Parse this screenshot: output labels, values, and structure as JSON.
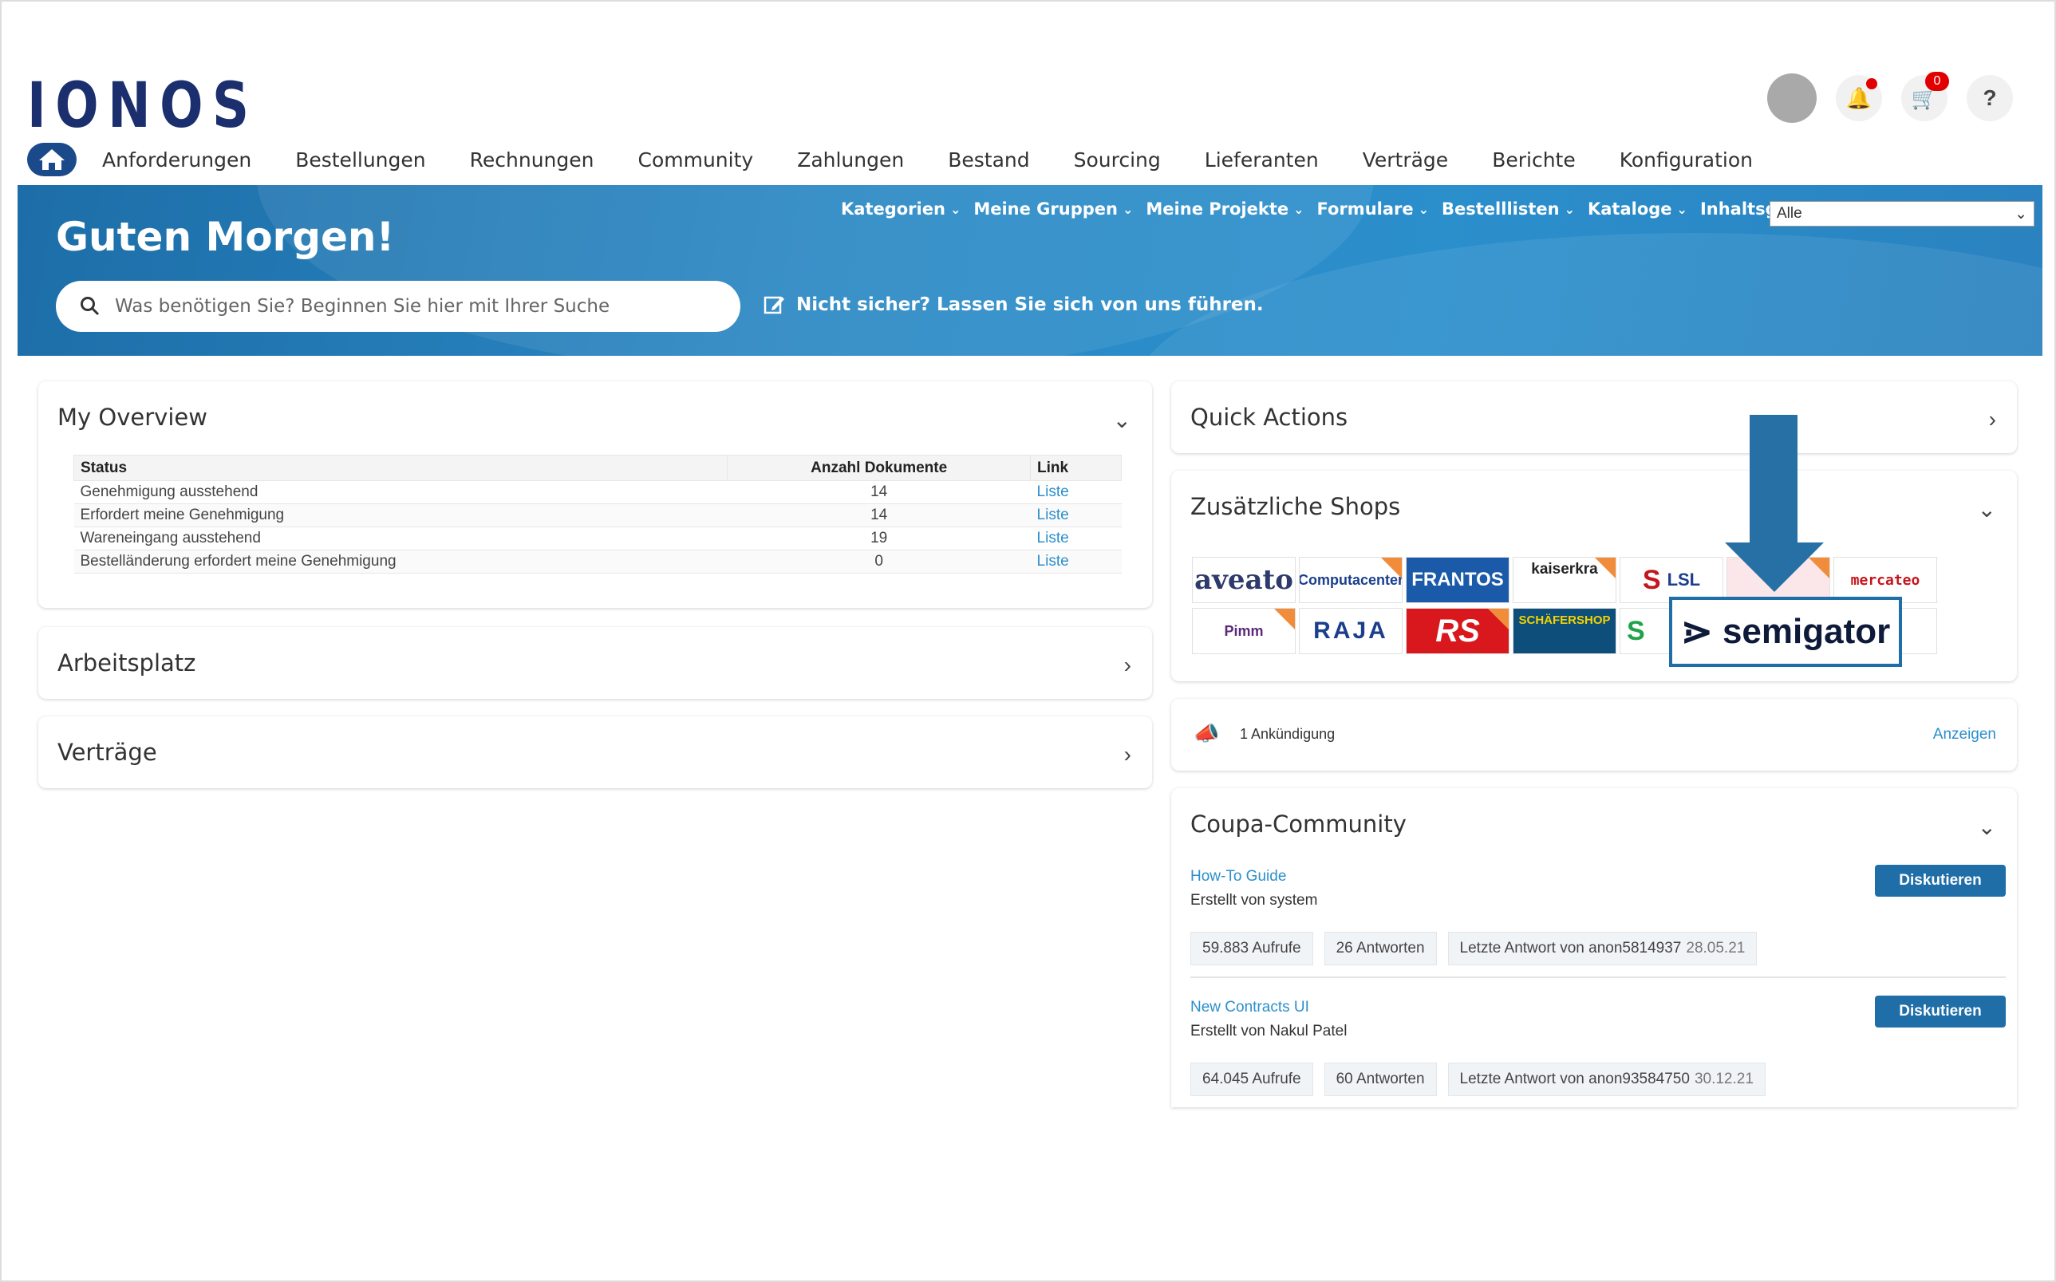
{
  "brand": {
    "logo": "IONOS"
  },
  "header": {
    "cart_count": "0",
    "help_symbol": "?"
  },
  "nav": {
    "items": [
      "Anforderungen",
      "Bestellungen",
      "Rechnungen",
      "Community",
      "Zahlungen",
      "Bestand",
      "Sourcing",
      "Lieferanten",
      "Verträge",
      "Berichte",
      "Konfiguration"
    ]
  },
  "banner": {
    "greeting": "Guten Morgen!",
    "subnav": [
      "Kategorien",
      "Meine Gruppen",
      "Meine Projekte",
      "Formulare",
      "Bestelllisten",
      "Kataloge"
    ],
    "groups_label": "Inhaltsgruppen",
    "groups_value": "Alle",
    "search_placeholder": "Was benötigen Sie? Beginnen Sie hier mit Ihrer Suche",
    "guide_text": "Nicht sicher? Lassen Sie sich von uns führen."
  },
  "overview": {
    "title": "My Overview",
    "columns": [
      "Status",
      "Anzahl Dokumente",
      "Link"
    ],
    "rows": [
      {
        "status": "Genehmigung ausstehend",
        "count": "14",
        "link": "Liste"
      },
      {
        "status": "Erfordert meine Genehmigung",
        "count": "14",
        "link": "Liste"
      },
      {
        "status": "Wareneingang ausstehend",
        "count": "19",
        "link": "Liste"
      },
      {
        "status": "Bestelländerung erfordert meine Genehmigung",
        "count": "0",
        "link": "Liste"
      }
    ]
  },
  "workspace": {
    "title": "Arbeitsplatz"
  },
  "contracts": {
    "title": "Verträge"
  },
  "quick_actions": {
    "title": "Quick Actions"
  },
  "shops": {
    "title": "Zusätzliche Shops",
    "row1": [
      "aveato",
      "Computacenter",
      "FRANTOS",
      "kaiserkra",
      "LSL",
      "",
      "mercateo"
    ],
    "row2": [
      "Pimm",
      "RAJA",
      "RS",
      "SCHÄFERSHOP",
      "",
      "",
      ""
    ],
    "highlight": "semigator"
  },
  "announcement": {
    "text": "1 Ankündigung",
    "link": "Anzeigen"
  },
  "community": {
    "title": "Coupa-Community",
    "button_label": "Diskutieren",
    "posts": [
      {
        "title": "How-To Guide",
        "author": "Erstellt von system",
        "views": "59.883 Aufrufe",
        "replies": "26 Antworten",
        "last": "Letzte Antwort von anon5814937",
        "date": "28.05.21"
      },
      {
        "title": "New Contracts UI",
        "author": "Erstellt von Nakul Patel",
        "views": "64.045 Aufrufe",
        "replies": "60 Antworten",
        "last": "Letzte Antwort von anon93584750",
        "date": "30.12.21"
      }
    ]
  },
  "colors": {
    "brand": "#1b2f6e",
    "banner": "#2a88c4",
    "link": "#2b8fcc",
    "button": "#1f6ea8",
    "alert": "#e10000"
  }
}
